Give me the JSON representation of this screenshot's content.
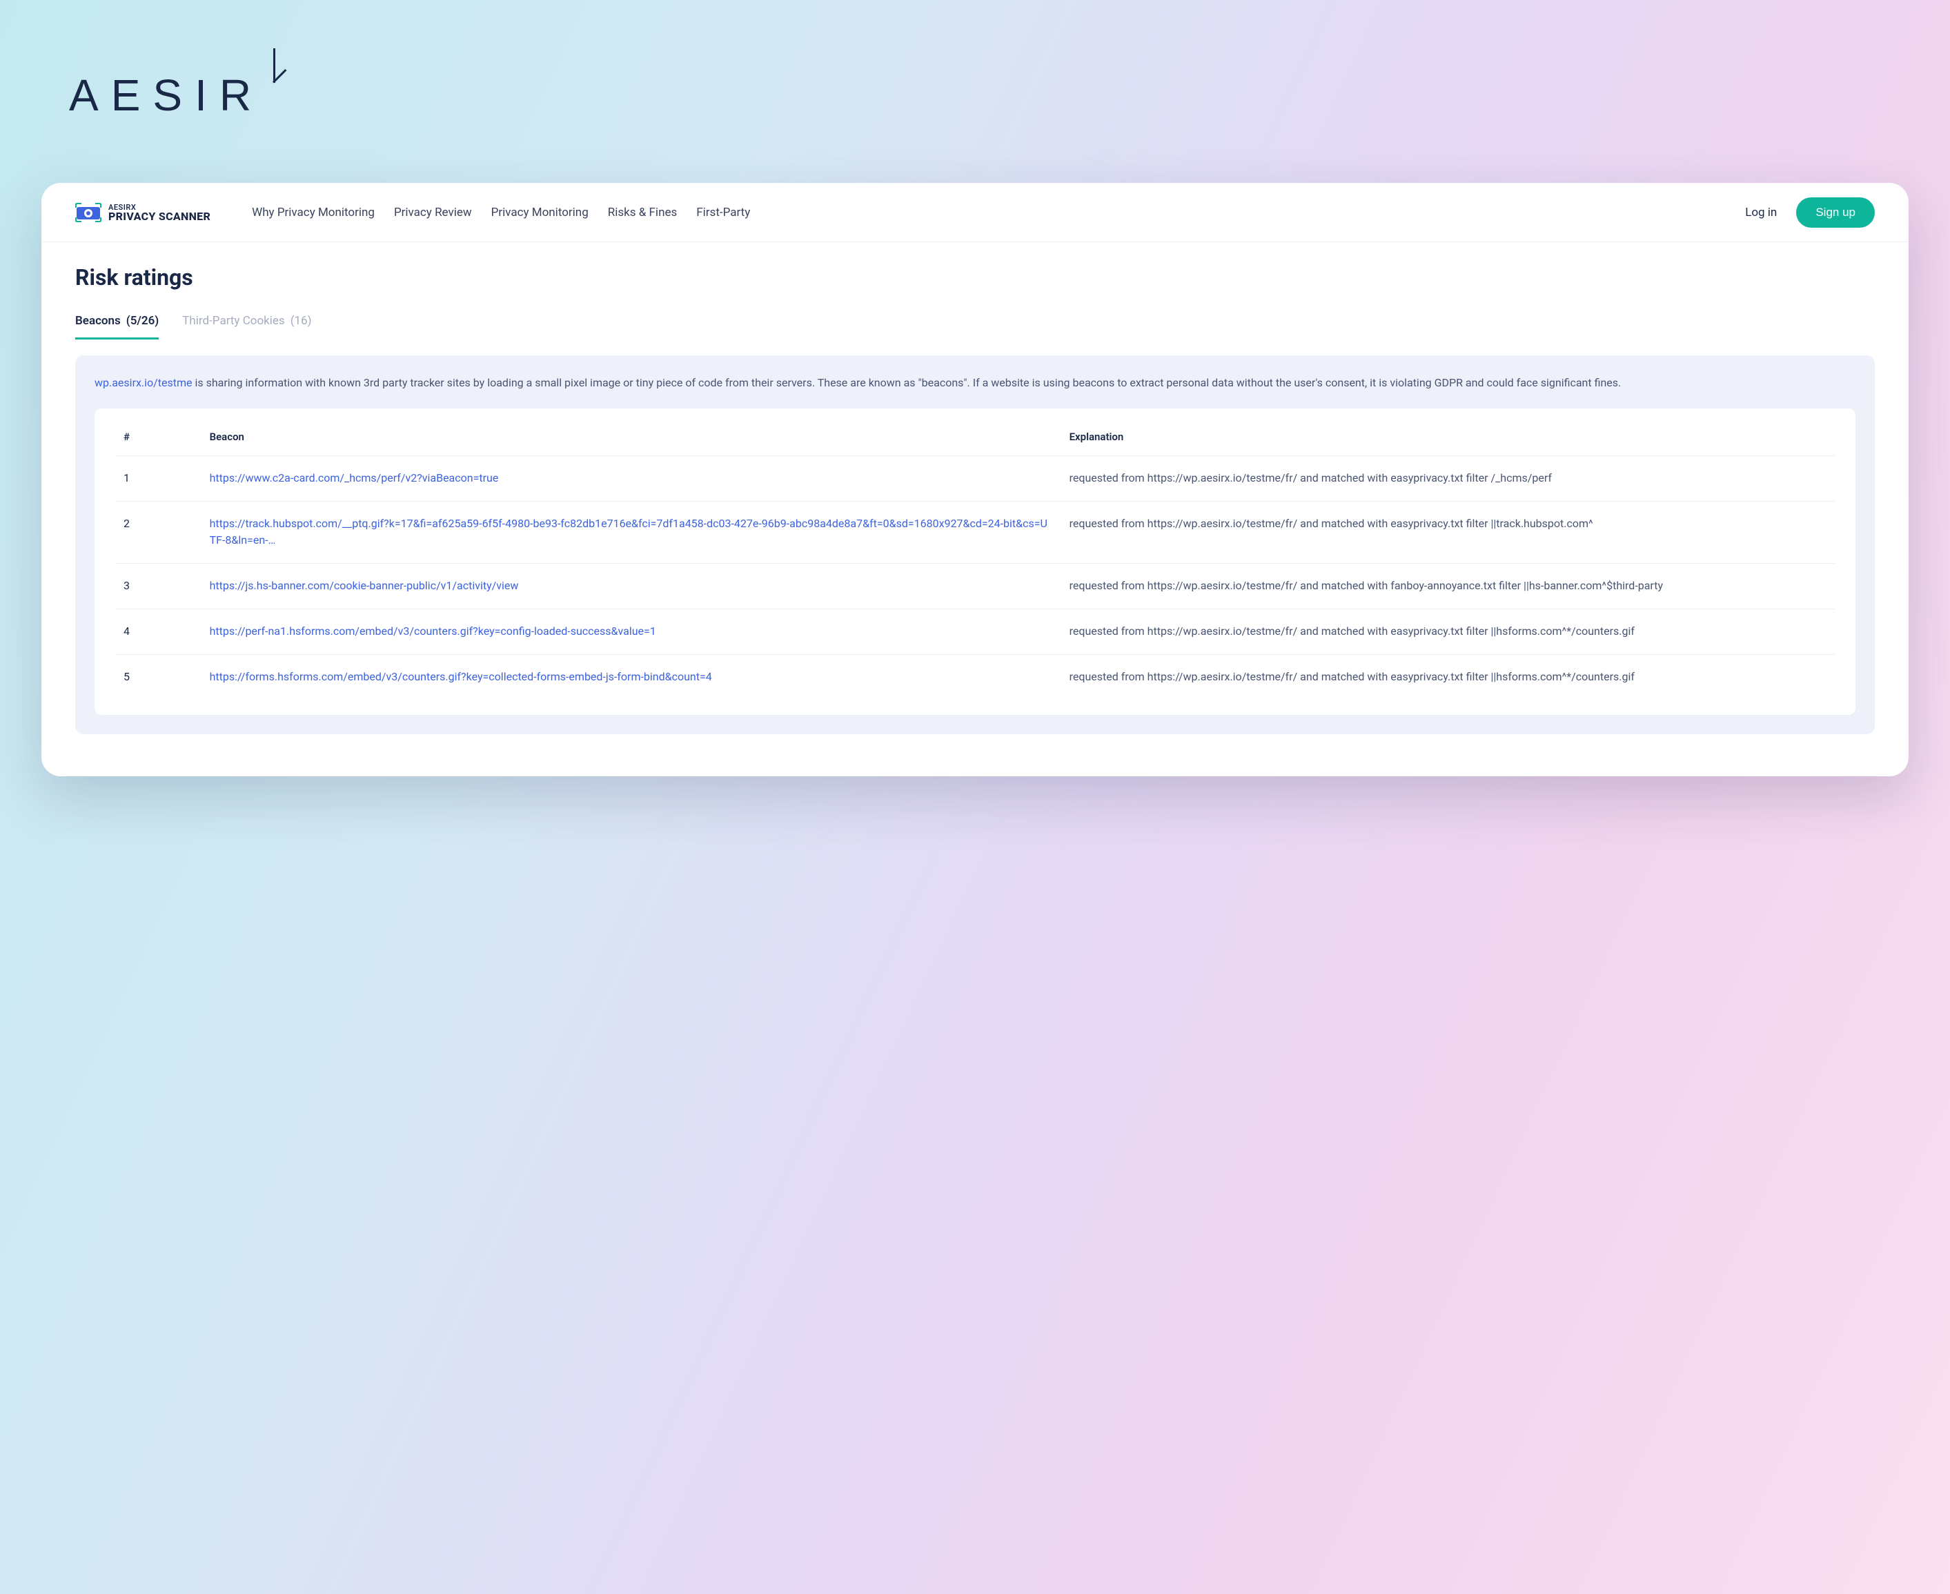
{
  "outer_brand": "AESIR",
  "header": {
    "brand_line1": "AESIRX",
    "brand_line2": "PRIVACY SCANNER",
    "nav": [
      "Why Privacy Monitoring",
      "Privacy Review",
      "Privacy Monitoring",
      "Risks & Fines",
      "First-Party"
    ],
    "login": "Log in",
    "signup": "Sign up"
  },
  "page": {
    "title": "Risk ratings",
    "tabs": [
      {
        "label": "Beacons",
        "count": "(5/26)",
        "active": true
      },
      {
        "label": "Third-Party Cookies",
        "count": "(16)",
        "active": false
      }
    ],
    "intro": {
      "domain": "wp.aesirx.io/testme",
      "text": " is sharing information with known 3rd party tracker sites by loading a small pixel image or tiny piece of code from their servers. These are known as \"beacons\". If a website is using beacons to extract personal data without the user's consent, it is violating GDPR and could face significant fines."
    },
    "table": {
      "col_idx": "#",
      "col_beacon": "Beacon",
      "col_expl": "Explanation",
      "rows": [
        {
          "n": "1",
          "beacon": "https://www.c2a-card.com/_hcms/perf/v2?viaBeacon=true",
          "expl": "requested from https://wp.aesirx.io/testme/fr/ and matched with easyprivacy.txt filter /_hcms/perf"
        },
        {
          "n": "2",
          "beacon": "https://track.hubspot.com/__ptq.gif?k=17&fi=af625a59-6f5f-4980-be93-fc82db1e716e&fci=7df1a458-dc03-427e-96b9-abc98a4de8a7&ft=0&sd=1680x927&cd=24-bit&cs=UTF-8&ln=en-…",
          "expl": "requested from https://wp.aesirx.io/testme/fr/ and matched with easyprivacy.txt filter ||track.hubspot.com^"
        },
        {
          "n": "3",
          "beacon": "https://js.hs-banner.com/cookie-banner-public/v1/activity/view",
          "expl": "requested from https://wp.aesirx.io/testme/fr/ and matched with fanboy-annoyance.txt filter ||hs-banner.com^$third-party"
        },
        {
          "n": "4",
          "beacon": "https://perf-na1.hsforms.com/embed/v3/counters.gif?key=config-loaded-success&value=1",
          "expl": "requested from https://wp.aesirx.io/testme/fr/ and matched with easyprivacy.txt filter ||hsforms.com^*/counters.gif"
        },
        {
          "n": "5",
          "beacon": "https://forms.hsforms.com/embed/v3/counters.gif?key=collected-forms-embed-js-form-bind&count=4",
          "expl": "requested from https://wp.aesirx.io/testme/fr/ and matched with easyprivacy.txt filter ||hsforms.com^*/counters.gif"
        }
      ]
    }
  }
}
